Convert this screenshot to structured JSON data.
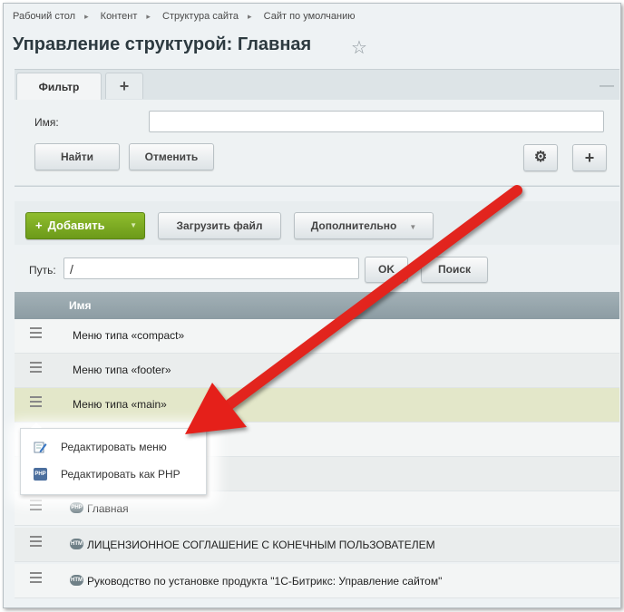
{
  "breadcrumb": [
    "Рабочий стол",
    "Контент",
    "Структура сайта",
    "Сайт по умолчанию"
  ],
  "page_title": "Управление структурой: Главная",
  "filter": {
    "tab_label": "Фильтр",
    "add_tab": "+",
    "name_label": "Имя:",
    "name_value": "",
    "find_button": "Найти",
    "cancel_button": "Отменить",
    "add_button": "+"
  },
  "toolbar": {
    "add_button": "Добавить",
    "upload_button": "Загрузить файл",
    "more_button": "Дополнительно"
  },
  "path": {
    "label": "Путь:",
    "value": "/",
    "ok_button": "OK",
    "search_button": "Поиск"
  },
  "grid": {
    "column_name": "Имя",
    "rows": [
      {
        "name": "Меню типа «compact»",
        "type": "menu"
      },
      {
        "name": "Меню типа «footer»",
        "type": "menu"
      },
      {
        "name": "Меню типа «main»",
        "type": "menu",
        "selected": true
      },
      {
        "name": "Главная",
        "type": "php"
      },
      {
        "name": "ЛИЦЕНЗИОННОЕ СОГЛАШЕНИЕ С КОНЕЧНЫМ ПОЛЬЗОВАТЕЛЕМ",
        "type": "htm"
      },
      {
        "name": "Руководство по установке продукта \"1С-Битрикс: Управление сайтом\"",
        "type": "htm"
      }
    ]
  },
  "context_menu": {
    "items": [
      "Редактировать меню",
      "Редактировать как PHP"
    ]
  },
  "file_icon_labels": {
    "php": "PHP",
    "htm": "HTM"
  },
  "colors": {
    "accent_green": "#7aa822",
    "annotation_arrow": "#e8211c"
  }
}
